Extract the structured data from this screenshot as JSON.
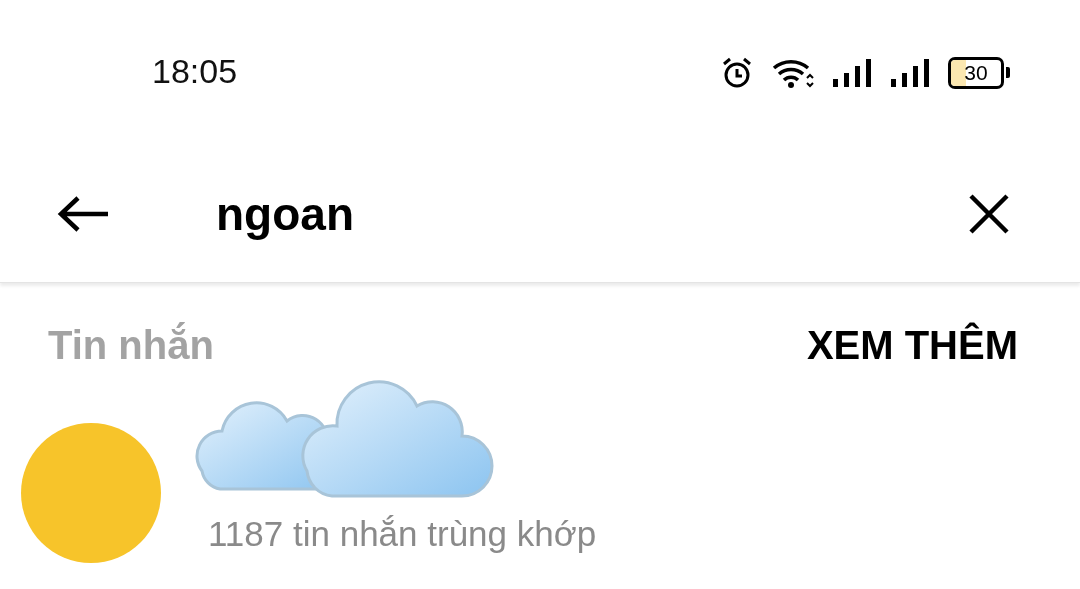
{
  "status_bar": {
    "time": "18:05",
    "battery": "30"
  },
  "search": {
    "value": "ngoan"
  },
  "section": {
    "title": "Tin nhắn",
    "action": "XEM THÊM"
  },
  "results": [
    {
      "kind": "conversation",
      "subtitle": "1187 tin nhắn trùng khớp"
    }
  ]
}
